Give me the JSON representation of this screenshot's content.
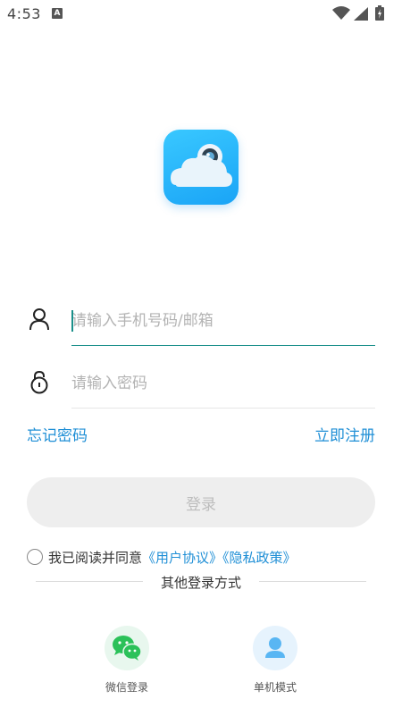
{
  "status_bar": {
    "time": "4:53",
    "notification_icon": "A"
  },
  "logo": {
    "icon": "cloud-camera-app-logo"
  },
  "login_form": {
    "account_placeholder": "请输入手机号码/邮箱",
    "account_value": "",
    "password_placeholder": "请输入密码",
    "password_value": "",
    "forgot_password": "忘记密码",
    "register": "立即注册",
    "login_button": "登录"
  },
  "agreement": {
    "prefix": "我已阅读并同意",
    "user_agreement": "《用户协议》",
    "privacy_policy": "《隐私政策》"
  },
  "other_login": {
    "title": "其他登录方式",
    "wechat_label": "微信登录",
    "offline_label": "单机模式"
  },
  "colors": {
    "accent_link": "#1f8fd6",
    "focus_line": "#1a8f8a",
    "wechat_green": "#2bc159",
    "offline_blue": "#59b6f3"
  }
}
